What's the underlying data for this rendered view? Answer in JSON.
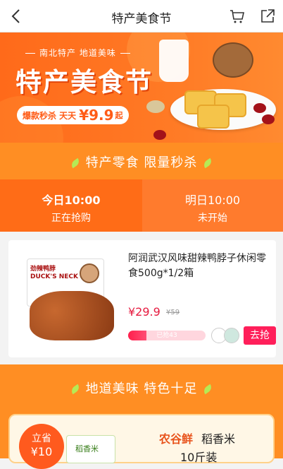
{
  "nav": {
    "title": "特产美食节",
    "back_icon": "chevron-left-icon",
    "cart_icon": "cart-icon",
    "share_icon": "share-icon"
  },
  "hero": {
    "subtitle": "南北特产 地道美味",
    "title": "特产美食节",
    "promo_text": "爆款秒杀 天天",
    "promo_price": "¥9.9",
    "promo_suffix": "起"
  },
  "flash_banner": {
    "label": "特产零食 限量秒杀"
  },
  "tabs": [
    {
      "prefix": "今日",
      "time": "10:00",
      "status": "正在抢购",
      "active": true
    },
    {
      "prefix": "明日",
      "time": "10:00",
      "status": "未开始",
      "active": false
    }
  ],
  "product": {
    "title": "阿润武汉风味甜辣鸭脖子休闲零食500g*1/2箱",
    "box_brand": "劲辣鸭脖",
    "box_en": "DUCK'S NECK",
    "price": "¥29.9",
    "original_price": "¥59",
    "sold_text": "已抢43",
    "sold_progress": 0.24,
    "buy_label": "去抢"
  },
  "section2": {
    "label": "地道美味 特色十足",
    "save_line1": "立省",
    "save_line2": "¥10",
    "bag_text": "稻香米",
    "brand": "农谷鲜",
    "name": "稻香米",
    "qty": "10斤装"
  },
  "colors": {
    "primary": "#ff6c17",
    "accent": "#ff1f5a",
    "price": "#e61a3f"
  }
}
